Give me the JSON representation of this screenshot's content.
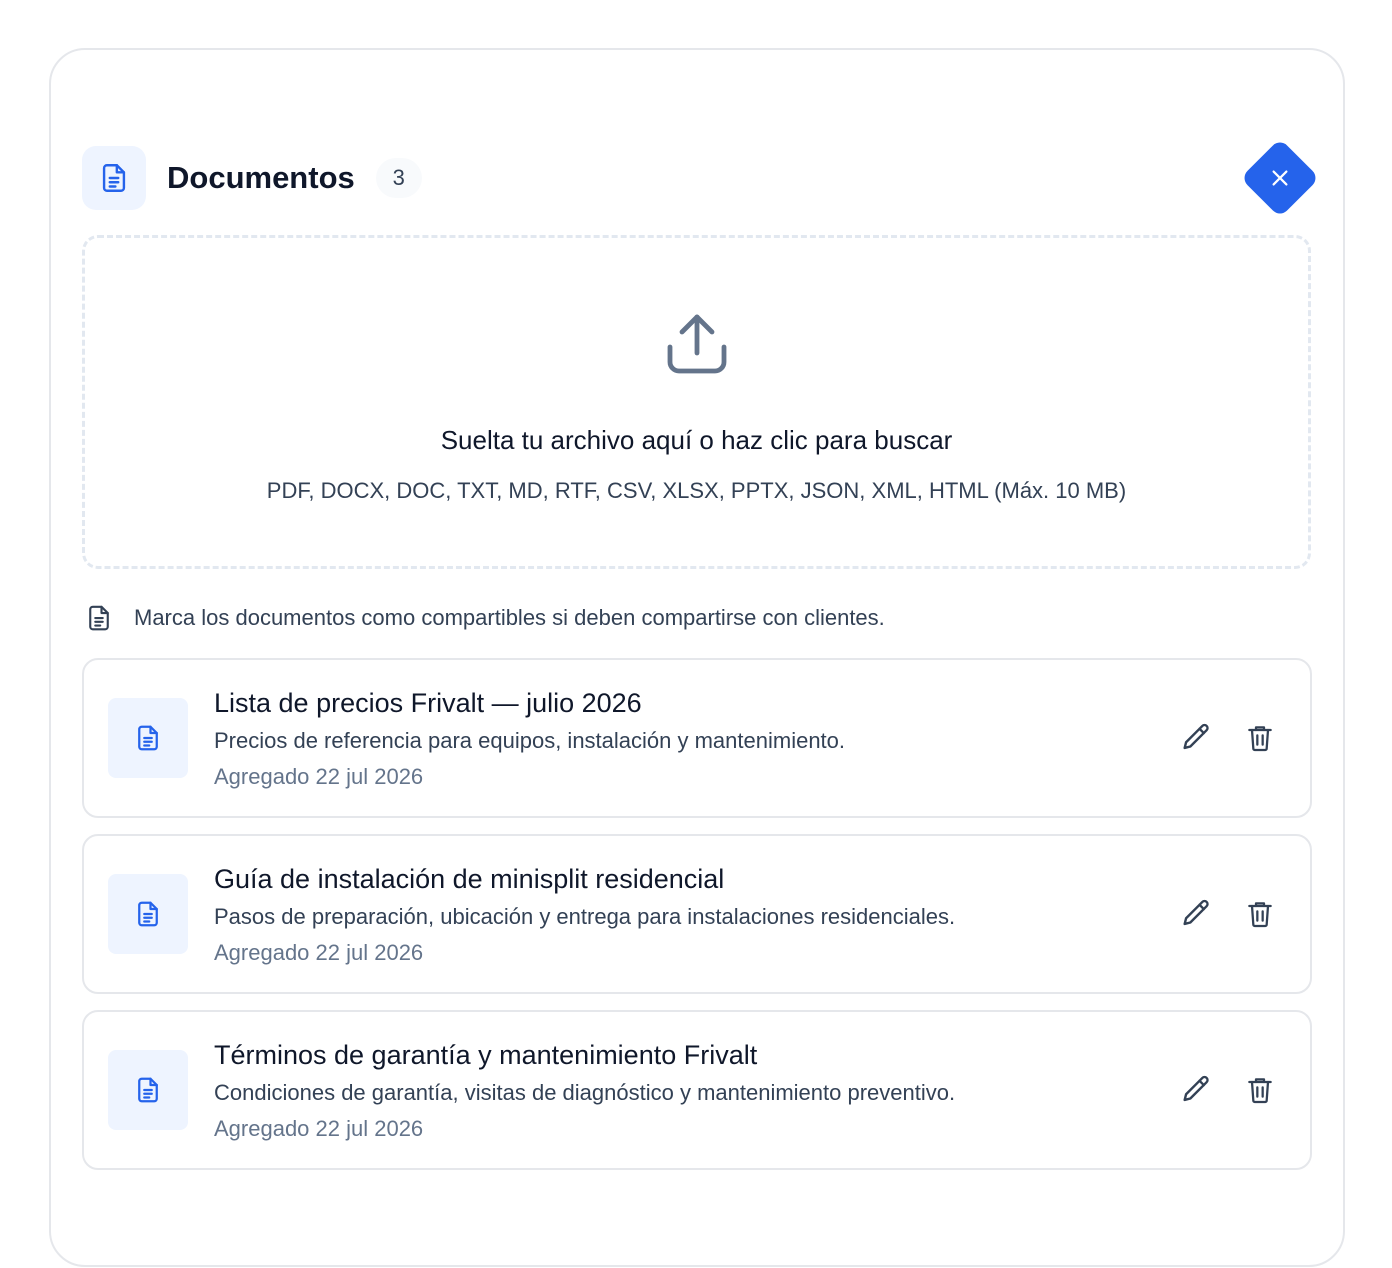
{
  "header": {
    "title": "Documentos",
    "count": "3",
    "icon": "document-icon",
    "close_icon": "close-icon"
  },
  "dropzone": {
    "icon": "upload-icon",
    "title": "Suelta tu archivo aquí o haz clic para buscar",
    "formats": "PDF, DOCX, DOC, TXT, MD, RTF, CSV, XLSX, PPTX, JSON, XML, HTML (Máx. 10 MB)"
  },
  "note": {
    "icon": "document-outline-icon",
    "text": "Marca los documentos como compartibles si deben compartirse con clientes."
  },
  "documents": [
    {
      "title": "Lista de precios Frivalt — julio 2026",
      "description": "Precios de referencia para equipos, instalación y mantenimiento.",
      "date": "Agregado 22 jul 2026"
    },
    {
      "title": "Guía de instalación de minisplit residencial",
      "description": "Pasos de preparación, ubicación y entrega para instalaciones residenciales.",
      "date": "Agregado 22 jul 2026"
    },
    {
      "title": "Términos de garantía y mantenimiento Frivalt",
      "description": "Condiciones de garantía, visitas de diagnóstico y mantenimiento preventivo.",
      "date": "Agregado 22 jul 2026"
    }
  ],
  "actions": {
    "edit_icon": "pencil-icon",
    "delete_icon": "trash-icon"
  },
  "colors": {
    "accent": "#2563eb",
    "icon_bg": "#eef4ff",
    "border": "#e5e7eb",
    "text_primary": "#0f172a",
    "text_secondary": "#334155",
    "text_muted": "#64748b"
  }
}
